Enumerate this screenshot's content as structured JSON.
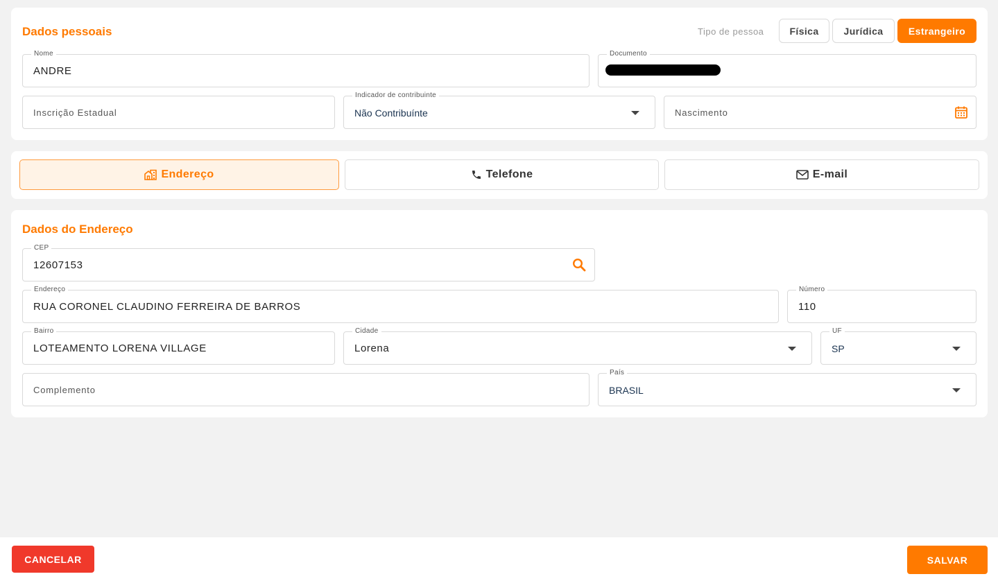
{
  "personal": {
    "title": "Dados pessoais",
    "tipo_label": "Tipo de pessoa",
    "tipo_options": [
      "Física",
      "Jurídica",
      "Estrangeiro"
    ],
    "tipo_selected": "Estrangeiro",
    "nome": {
      "label": "Nome",
      "value": "ANDRE"
    },
    "documento": {
      "label": "Documento",
      "value": ""
    },
    "inscricao": {
      "placeholder": "Inscrição Estadual"
    },
    "indicador": {
      "label": "Indicador de contribuinte",
      "value": "Não Contribuínte"
    },
    "nascimento": {
      "placeholder": "Nascimento"
    }
  },
  "tabs": [
    {
      "label": "Endereço",
      "icon": "building-icon",
      "active": true
    },
    {
      "label": "Telefone",
      "icon": "phone-icon",
      "active": false
    },
    {
      "label": "E-mail",
      "icon": "mail-icon",
      "active": false
    }
  ],
  "address": {
    "title": "Dados do Endereço",
    "cep": {
      "label": "CEP",
      "value": "12607153"
    },
    "endereco": {
      "label": "Endereço",
      "value": "RUA CORONEL CLAUDINO FERREIRA DE BARROS"
    },
    "numero": {
      "label": "Número",
      "value": "110"
    },
    "bairro": {
      "label": "Bairro",
      "value": "LOTEAMENTO LORENA VILLAGE"
    },
    "cidade": {
      "label": "Cidade",
      "value": "Lorena"
    },
    "uf": {
      "label": "UF",
      "value": "SP"
    },
    "complemento": {
      "placeholder": "Complemento"
    },
    "pais": {
      "label": "País",
      "value": "BRASIL"
    }
  },
  "footer": {
    "cancel": "CANCELAR",
    "save": "SALVAR"
  },
  "colors": {
    "accent": "#ff7a00",
    "cancel": "#f0392b",
    "background": "#f2f2f2"
  }
}
